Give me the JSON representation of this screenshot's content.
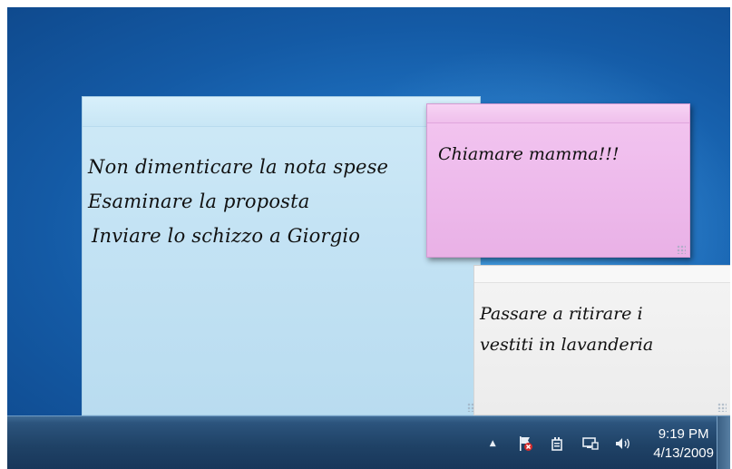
{
  "notes": {
    "blue": {
      "lines": [
        "Non dimenticare la nota spese",
        "Esaminare la proposta",
        "Inviare lo schizzo a Giorgio"
      ],
      "color": "#c4e3f4"
    },
    "pink": {
      "lines": [
        "Chiamare mamma!!!"
      ],
      "color": "#eebbec"
    },
    "white": {
      "lines": [
        "Passare a ritirare i",
        "vestiti in lavanderia"
      ],
      "color": "#eeeeee"
    }
  },
  "taskbar": {
    "tray": {
      "icons": [
        "show-hidden-icons-arrow-icon",
        "action-center-flag-icon",
        "power-icon",
        "network-icon",
        "volume-icon"
      ],
      "arrow_glyph": "▲",
      "time": "9:19 PM",
      "date": "4/13/2009"
    }
  },
  "colors": {
    "desktop": "#1d6fbe",
    "taskbar": "#1f4266"
  }
}
